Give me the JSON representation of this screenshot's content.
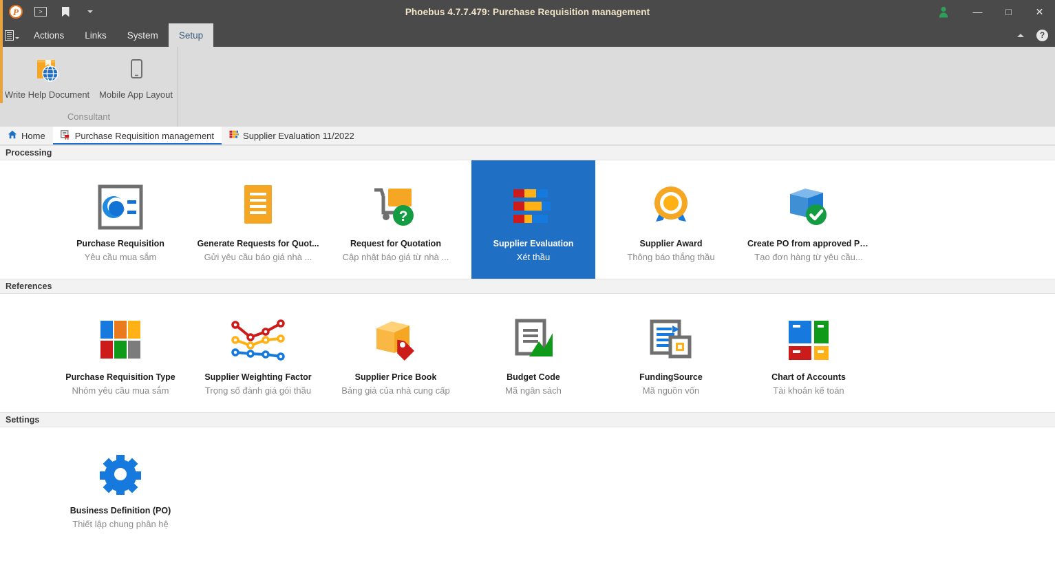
{
  "titlebar": {
    "title": "Phoebus 4.7.7.479: Purchase Requisition management",
    "quick_access": [
      {
        "name": "app-logo",
        "glyph": "P"
      },
      {
        "name": "script-icon",
        "glyph": ">"
      },
      {
        "name": "bookmark-icon",
        "glyph": ""
      },
      {
        "name": "quick-access-dropdown",
        "glyph": ""
      }
    ],
    "user_icon": "user-icon",
    "minimize": "—",
    "maximize": "□",
    "close": "✕"
  },
  "menubar": {
    "menu_icon": "document-menu-icon",
    "items": [
      {
        "label": "Actions",
        "active": false
      },
      {
        "label": "Links",
        "active": false
      },
      {
        "label": "System",
        "active": false
      },
      {
        "label": "Setup",
        "active": true
      }
    ],
    "collapse_ribbon": "chevron-up-icon",
    "help": "?"
  },
  "ribbon": {
    "group_title": "Consultant",
    "items": [
      {
        "label": "Write Help Document",
        "icon": "help-book-globe-icon"
      },
      {
        "label": "Mobile App Layout",
        "icon": "mobile-phone-icon"
      }
    ]
  },
  "tabs": [
    {
      "label": "Home",
      "icon": "home-icon",
      "active": false
    },
    {
      "label": "Purchase Requisition management",
      "icon": "purchase-requisition-icon",
      "active": true
    },
    {
      "label": "Supplier Evaluation 11/2022",
      "icon": "supplier-evaluation-icon",
      "active": false
    }
  ],
  "sections": [
    {
      "header": "Processing",
      "tiles": [
        {
          "title": "Purchase Requisition",
          "subtitle": "Yêu cầu mua sắm",
          "icon": "purchase-requisition-icon",
          "selected": false
        },
        {
          "title": "Generate Requests for Quot...",
          "subtitle": "Gửi yêu cầu báo giá nhà ...",
          "icon": "list-lines-icon",
          "selected": false
        },
        {
          "title": "Request for Quotation",
          "subtitle": "Cập nhật báo giá từ nhà ...",
          "icon": "cart-question-icon",
          "selected": false
        },
        {
          "title": "Supplier Evaluation",
          "subtitle": "Xét thầu",
          "icon": "stacked-bars-icon",
          "selected": true
        },
        {
          "title": "Supplier Award",
          "subtitle": "Thông báo thắng thầu",
          "icon": "award-medal-icon",
          "selected": false
        },
        {
          "title": "Create PO from approved PRs",
          "subtitle": "Tạo đơn hàng từ yêu cầu...",
          "icon": "box-check-icon",
          "selected": false
        }
      ]
    },
    {
      "header": "References",
      "tiles": [
        {
          "title": "Purchase Requisition Type",
          "subtitle": "Nhóm yêu cầu mua sắm",
          "icon": "color-grid-icon",
          "selected": false
        },
        {
          "title": "Supplier Weighting Factor",
          "subtitle": "Trọng số đánh giá gói thầu",
          "icon": "line-chart-icon",
          "selected": false
        },
        {
          "title": "Supplier Price Book",
          "subtitle": "Bảng giá của nhà cung cấp",
          "icon": "box-tag-icon",
          "selected": false
        },
        {
          "title": "Budget Code",
          "subtitle": "Mã ngân sách",
          "icon": "document-chart-icon",
          "selected": false
        },
        {
          "title": "FundingSource",
          "subtitle": "Mã nguồn vốn",
          "icon": "document-square-icon",
          "selected": false
        },
        {
          "title": "Chart of Accounts",
          "subtitle": "Tài khoản kế toán",
          "icon": "accounts-blocks-icon",
          "selected": false
        }
      ]
    },
    {
      "header": "Settings",
      "tiles": [
        {
          "title": "Business Definition (PO)",
          "subtitle": "Thiết lập chung phân hệ",
          "icon": "gear-icon",
          "selected": false
        }
      ]
    }
  ],
  "colors": {
    "accent_blue": "#1f6fc4",
    "title_bar": "#4a4a4a",
    "ribbon": "#dcdcdc",
    "orange": "#f2a818",
    "red": "#cc1b1b",
    "green": "#1ba01b",
    "title_text": "#f2e6c8"
  }
}
